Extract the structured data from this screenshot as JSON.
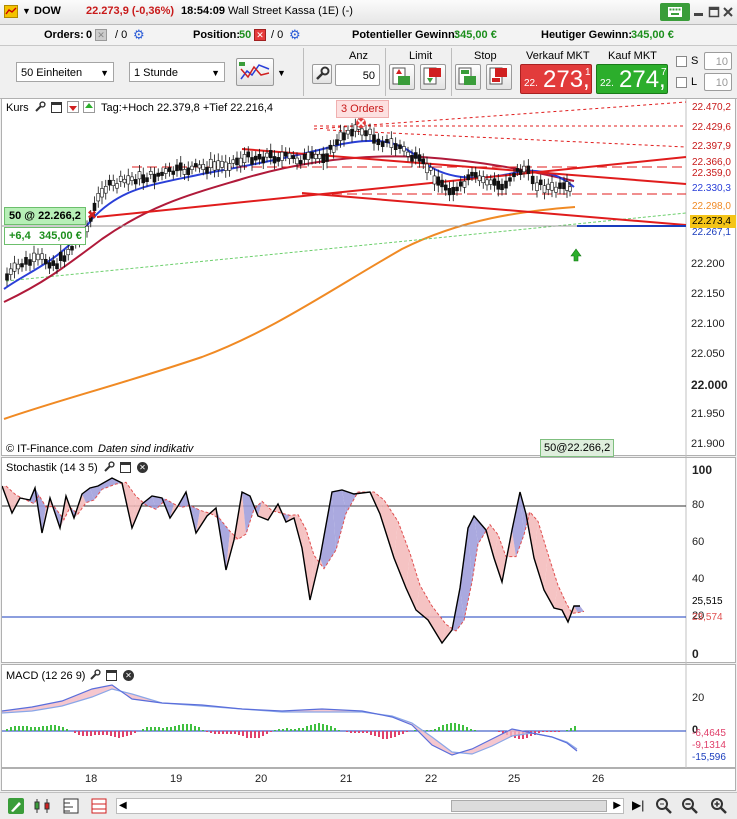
{
  "header": {
    "symbol": "DOW",
    "quote": "22.273,9 (-0,36%)",
    "time": "18:54:09",
    "name": "Wall Street Kassa (1E) (-)"
  },
  "info": {
    "orders_label": "Orders:",
    "orders_value": "0",
    "orders_sep": "/ 0",
    "position_label": "Position:",
    "position_value": "50",
    "position_sep": "/ 0",
    "potential_label": "Potentieller Gewinn:",
    "potential_value": "345,00 €",
    "today_label": "Heutiger Gewinn:",
    "today_value": "345,00 €"
  },
  "toolbar": {
    "units_select": "50 Einheiten",
    "interval_select": "1 Stunde",
    "qty_label": "Anz",
    "qty_value": "50",
    "limit_label": "Limit",
    "stop_label": "Stop",
    "sell_label": "Verkauf MKT",
    "sell_prefix": "22.",
    "sell_big": "273,",
    "sell_sup": "1",
    "buy_label": "Kauf MKT",
    "buy_prefix": "22.",
    "buy_big": "274,",
    "buy_sup": "7",
    "s_label": "S",
    "s_value": "10",
    "l_label": "L",
    "l_value": "10"
  },
  "price_panel": {
    "title": "Kurs",
    "info": "Tag:+Hoch 22.379,8 +Tief 22.216,4",
    "orders_badge": "3 Orders",
    "position_badge": "50 @ 22.266,2",
    "pl_points": "+6,4",
    "pl_money": "345,00 €",
    "copyright": "© IT-Finance.com",
    "disclaimer": "Daten sind indikativ",
    "entry_marker": "50@22.266,2",
    "y_ticks": [
      "22.200",
      "22.150",
      "22.100",
      "22.050",
      "22.000",
      "21.950",
      "21.900"
    ],
    "price_labels": [
      {
        "text": "22.470,2",
        "color": "#c81a1a",
        "bg": "#ffffff"
      },
      {
        "text": "22.429,6",
        "color": "#c81a1a",
        "bg": "#ffffff"
      },
      {
        "text": "22.397,9",
        "color": "#c81a1a",
        "bg": "#ffffff"
      },
      {
        "text": "22.366,0",
        "color": "#c81a1a",
        "bg": "#ffffff"
      },
      {
        "text": "22.359,0",
        "color": "#c81a1a",
        "bg": "#ffffff"
      },
      {
        "text": "22.330,3",
        "color": "#2a3fd8",
        "bg": "#ffffff"
      },
      {
        "text": "22.298,0",
        "color": "#f08a24",
        "bg": "#ffffff"
      },
      {
        "text": "22.273,4",
        "color": "#000000",
        "bg": "#f5c518"
      },
      {
        "text": "22.267,1",
        "color": "#1a3dbd",
        "bg": "#ffffff"
      }
    ]
  },
  "stoch_panel": {
    "title": "Stochastik (14 3 5)",
    "y_ticks": [
      "100",
      "80",
      "60",
      "40",
      "20",
      "0"
    ],
    "k_value": "25,515",
    "d_value": "23,574"
  },
  "macd_panel": {
    "title": "MACD (12 26 9)",
    "y_ticks": [
      "20",
      "0"
    ],
    "v1": "-6,4645",
    "v2": "-9,1314",
    "v3": "-15,596"
  },
  "x_axis": {
    "dates": [
      "18",
      "19",
      "20",
      "21",
      "22",
      "25",
      "26"
    ]
  },
  "colors": {
    "sell": "#e23b3b",
    "buy": "#2cae2c",
    "sma_fast": "#2a3fd8",
    "sma_mid": "#b01a3a",
    "sma_slow": "#f08a24",
    "trend": "#e01c1c"
  },
  "icons": [
    "window-icon",
    "wrench-icon",
    "maximize-icon",
    "close-icon",
    "settings-icon",
    "pen-icon",
    "zoom-in-icon",
    "zoom-out-icon"
  ]
}
